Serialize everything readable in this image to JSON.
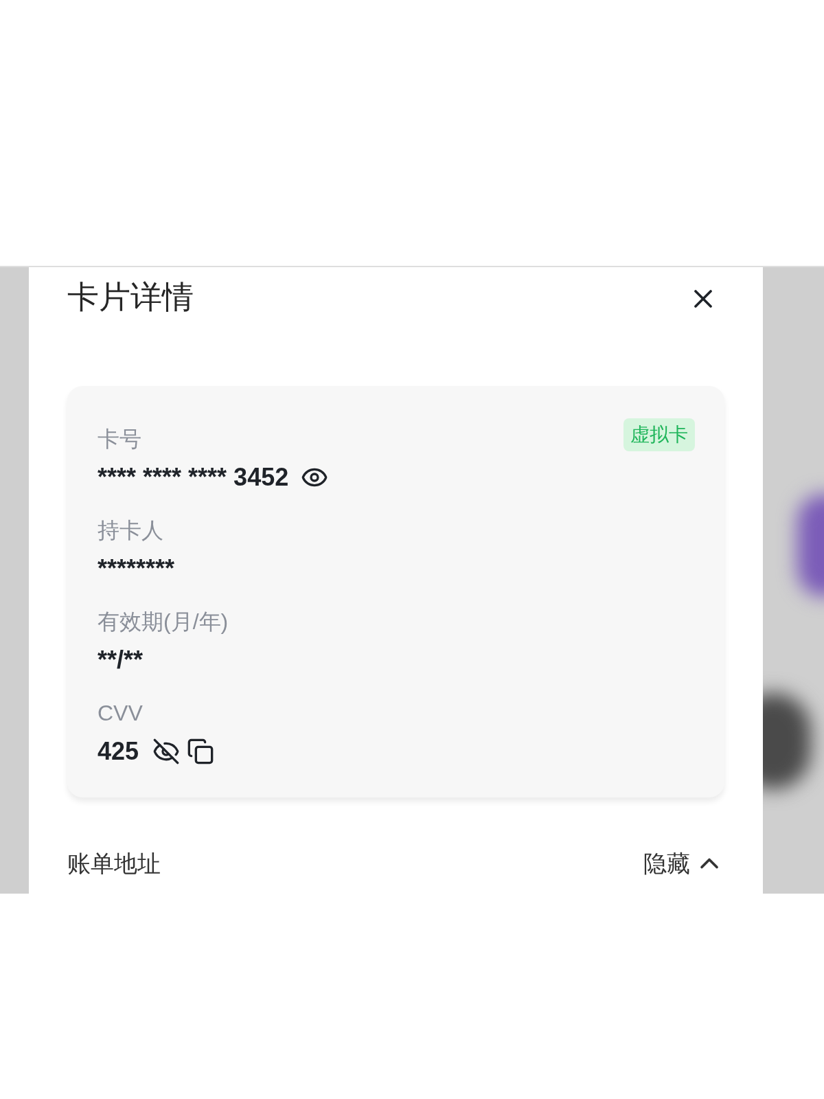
{
  "dialog": {
    "title": "卡片详情"
  },
  "card": {
    "badge": "虚拟卡",
    "fields": [
      {
        "kind": "number",
        "label": "卡号",
        "value": "**** **** **** 3452",
        "revealed": false
      },
      {
        "kind": "plain",
        "label": "持卡人",
        "value": "********"
      },
      {
        "kind": "plain",
        "label": "有效期(月/年)",
        "value": "**/**"
      },
      {
        "kind": "cvv",
        "label": "CVV",
        "value": "425",
        "revealed": true
      }
    ]
  },
  "billing_address": {
    "title": "账单地址",
    "toggle_label": "隐藏",
    "expanded": true
  }
}
